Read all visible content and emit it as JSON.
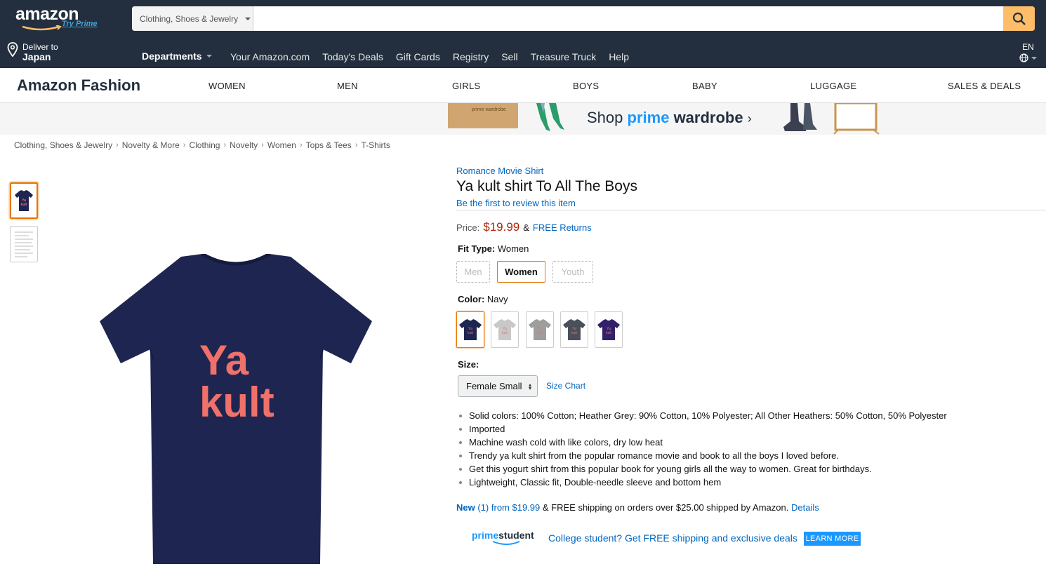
{
  "header": {
    "logo_text": "amazon",
    "try_prime": "Try Prime",
    "search_category": "Clothing, Shoes & Jewelry",
    "search_placeholder": "",
    "deliver_line1": "Deliver to",
    "deliver_line2": "Japan",
    "departments": "Departments",
    "nav_links": [
      "Your Amazon.com",
      "Today's Deals",
      "Gift Cards",
      "Registry",
      "Sell",
      "Treasure Truck",
      "Help"
    ],
    "language": "EN",
    "icons": {
      "search": "search-icon",
      "location": "location-pin-icon",
      "globe": "globe-icon"
    },
    "colors": {
      "nav_bg": "#232f3e",
      "search_button": "#febd69"
    }
  },
  "fashion_nav": {
    "title": "Amazon Fashion",
    "items": [
      "WOMEN",
      "MEN",
      "GIRLS",
      "BOYS",
      "BABY",
      "LUGGAGE",
      "SALES & DEALS"
    ]
  },
  "banner": {
    "box_label": "prime wardrobe",
    "shop": "Shop",
    "prime": "prime",
    "wardrobe": "wardrobe",
    "arrow": "›"
  },
  "breadcrumb": [
    "Clothing, Shoes & Jewelry",
    "Novelty & More",
    "Clothing",
    "Novelty",
    "Women",
    "Tops & Tees",
    "T-Shirts"
  ],
  "breadcrumb_sep": "›",
  "product": {
    "brand": "Romance Movie Shirt",
    "title": "Ya kult shirt To All The Boys",
    "review_link": "Be the first to review this item",
    "price_label": "Price:",
    "price": "$19.99",
    "amp": "&",
    "free_returns": "FREE Returns",
    "shirt_text_line1": "Ya",
    "shirt_text_line2": "kult",
    "shirt_color": "#1e2550",
    "print_color": "#f0706a"
  },
  "fit_type": {
    "label": "Fit Type:",
    "selected": "Women",
    "options": [
      "Men",
      "Women",
      "Youth"
    ]
  },
  "color": {
    "label": "Color:",
    "selected": "Navy",
    "swatches": [
      "#1e2550",
      "#c8c8c8",
      "#9e9e9e",
      "#4a4f5a",
      "#34206a"
    ]
  },
  "size": {
    "label": "Size:",
    "selected": "Female Small",
    "size_chart": "Size Chart"
  },
  "bullets": [
    "Solid colors: 100% Cotton; Heather Grey: 90% Cotton, 10% Polyester; All Other Heathers: 50% Cotton, 50% Polyester",
    "Imported",
    "Machine wash cold with like colors, dry low heat",
    "Trendy ya kult shirt from the popular romance movie and book to all the boys I loved before.",
    "Get this yogurt shirt from this popular book for young girls all the way to women. Great for birthdays.",
    "Lightweight, Classic fit, Double-needle sleeve and bottom hem"
  ],
  "offer": {
    "new_label": "New",
    "count": "(1)",
    "from": "from $19.99",
    "rest": "& FREE shipping on orders over $25.00 shipped by Amazon.",
    "details": "Details"
  },
  "prime_student": {
    "prime": "prime",
    "student": "student",
    "college_text": "College student? Get FREE shipping and exclusive deals",
    "learn_more": "LEARN MORE"
  }
}
